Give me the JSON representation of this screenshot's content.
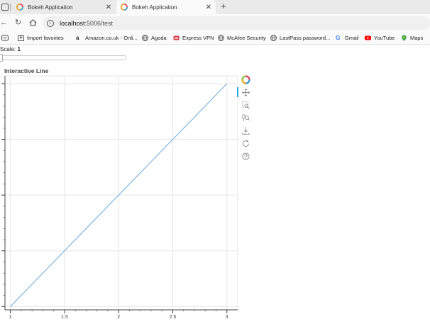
{
  "browser": {
    "tabs": [
      {
        "title": "Bokeh Application",
        "active": false
      },
      {
        "title": "Bokeh Application",
        "active": true
      }
    ],
    "address": {
      "host": "localhost",
      "path": ":5006/test"
    },
    "bookmarks": [
      {
        "label": "Import favorites",
        "icon": "import-icon"
      },
      {
        "label": "Amazon.co.uk - Onli...",
        "icon": "amazon-icon"
      },
      {
        "label": "Agoda",
        "icon": "globe-icon"
      },
      {
        "label": "Express VPN",
        "icon": "expressvpn-icon"
      },
      {
        "label": "McAfee Security",
        "icon": "globe-icon"
      },
      {
        "label": "LastPass password...",
        "icon": "globe-icon"
      },
      {
        "label": "Gmail",
        "icon": "google-icon"
      },
      {
        "label": "YouTube",
        "icon": "youtube-icon"
      },
      {
        "label": "Maps",
        "icon": "maps-icon"
      }
    ]
  },
  "controls": {
    "slider_title": "Scale: ",
    "slider_value": "1",
    "slider_value_num": 1
  },
  "chart_data": {
    "type": "line",
    "title": "Interactive Line",
    "x": [
      1,
      3
    ],
    "y": [
      1,
      3
    ],
    "xlim": [
      0.95,
      3.1
    ],
    "ylim": [
      0.97,
      3.07
    ],
    "x_ticks": [
      1,
      1.5,
      2,
      2.5,
      3
    ],
    "x_tick_labels": [
      "1",
      "1.5",
      "2",
      "2.5",
      "3"
    ],
    "y_ticks": [
      1,
      1.5,
      2,
      2.5,
      3
    ],
    "grid": true,
    "line_color": "#7fb6e6",
    "y_tick_labels_visible": false
  },
  "bokeh_toolbar": {
    "tools": [
      "bokeh-logo",
      "pan-icon",
      "box-zoom-icon",
      "wheel-zoom-icon",
      "save-icon",
      "reset-icon",
      "help-icon"
    ]
  },
  "colors": {
    "accent": "#26aae1",
    "grid": "#e6e6e6",
    "axis": "#444444"
  }
}
